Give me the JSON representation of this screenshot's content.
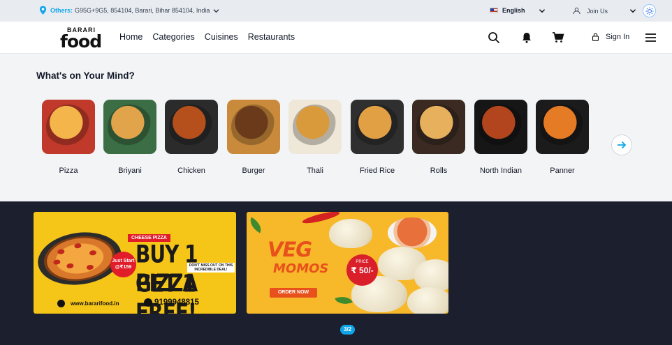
{
  "topbar": {
    "location_label": "Others:",
    "location_value": "G95G+9G5, 854104, Barari, Bihar 854104, India",
    "language": "English",
    "join_us": "Join Us"
  },
  "header": {
    "logo_top": "BARARI",
    "logo_main": "food",
    "nav": [
      "Home",
      "Categories",
      "Cuisines",
      "Restaurants"
    ],
    "sign_in": "Sign In"
  },
  "categories": {
    "title": "What's on Your Mind?",
    "items": [
      {
        "name": "Pizza",
        "color": "#c0392b",
        "accent": "#f4b54a"
      },
      {
        "name": "Briyani",
        "color": "#3b6e44",
        "accent": "#e2a44a"
      },
      {
        "name": "Chicken",
        "color": "#2b2b2b",
        "accent": "#b5501d"
      },
      {
        "name": "Burger",
        "color": "#c98a3b",
        "accent": "#6b3a1b"
      },
      {
        "name": "Thali",
        "color": "#efe7d8",
        "accent": "#d89a3a"
      },
      {
        "name": "Fried Rice",
        "color": "#2f2f2f",
        "accent": "#e0a043"
      },
      {
        "name": "Rolls",
        "color": "#3a2a22",
        "accent": "#e6b05c"
      },
      {
        "name": "North Indian",
        "color": "#161616",
        "accent": "#b3451e"
      },
      {
        "name": "Panner",
        "color": "#1b1b1b",
        "accent": "#e57b25"
      }
    ]
  },
  "banners": [
    {
      "tag": "CHEESE PIZZA",
      "line1": "BUY 1 PIZZA",
      "line2": "GET 1 FREE!",
      "badge_line1": "Just Start",
      "badge_line2": "@₹159",
      "note": "DON'T MISS OUT ON THIS INCREDIBLE DEAL!",
      "website": "www.bararifood.in",
      "phone": "9199948815"
    },
    {
      "title": "VEG",
      "subtitle": "MOMOS",
      "cta": "ORDER NOW",
      "price_label": "PRICE",
      "price_value": "₹ 50/-"
    }
  ],
  "pager": "3/2",
  "colors": {
    "accent": "#0ea5e9",
    "dark_bg": "#1c1f2e",
    "banner1": "#f5c518",
    "banner2": "#f7b929"
  }
}
